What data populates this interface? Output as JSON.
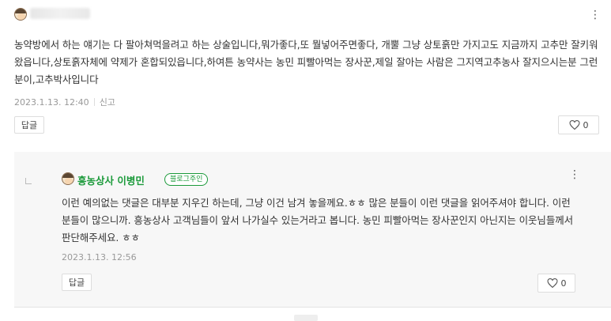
{
  "comment": {
    "author_blurred": true,
    "body": "농약방에서 하는 얘기는 다 팔아쳐먹을려고 하는 상술입니다,뭐가좋다,또 뭘넣어주면좋다, 개뿔 그냥 상토흙만 가지고도 지금까지 고추만 잘키워왔읍니다,상토흙자체에 약제가 혼합되있읍니다,하여튼 농약사는 농민 피빨아먹는 장사꾼,제일 잘아는 사람은 그지역고추농사 잘지으시는분 그런분이,고추박사입니다",
    "date": "2023.1.13. 12:40",
    "report_label": "신고",
    "reply_button": "답글",
    "like_count": "0",
    "more_icon": "⋮"
  },
  "reply": {
    "author": "흥농상사 이병민",
    "badge": "블로그주인",
    "body": "이런 예의없는 댓글은 대부분 지우긴 하는데, 그냥 이건 남겨 놓을께요.ㅎㅎ 많은 분들이 이런 댓글을 읽어주셔야 합니다. 이런 분들이 많으니까. 흥농상사 고객님들이 앞서 나가실수 있는거라고 봅니다. 농민 피빨아먹는 장사꾼인지 아닌지는 이웃님들께서 판단해주세요. ㅎㅎ",
    "date": "2023.1.13. 12:56",
    "reply_button": "답글",
    "like_count": "0",
    "more_icon": "⋮"
  },
  "icons": {
    "heart": "heart-outline-icon",
    "more": "vertical-dots-icon"
  },
  "colors": {
    "owner_green": "#1b9a3a",
    "reply_bg": "#f7f7f7"
  }
}
